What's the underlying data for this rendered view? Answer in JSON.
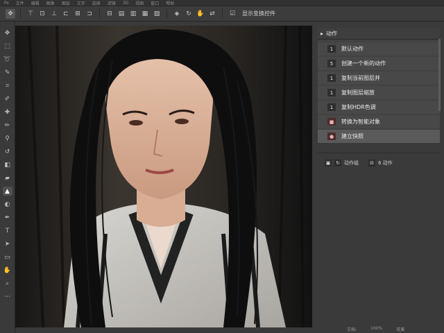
{
  "menubar": {
    "items": [
      "Ps",
      "文件",
      "编辑",
      "图像",
      "图层",
      "文字",
      "选择",
      "滤镜",
      "3D",
      "视图",
      "窗口",
      "帮助"
    ]
  },
  "options": {
    "label": "显示变换控件"
  },
  "panel": {
    "title": "动作",
    "rows": [
      {
        "num": "1",
        "label": "默认动作",
        "active": false,
        "hist": false
      },
      {
        "num": "5",
        "label": "创建一个新的动作",
        "active": false,
        "hist": false
      },
      {
        "num": "1",
        "label": "复制当前图层并",
        "active": false,
        "hist": false
      },
      {
        "num": "1",
        "label": "复制图层缩放",
        "active": false,
        "hist": false
      },
      {
        "num": "1",
        "label": "复制HDR色调",
        "active": false,
        "hist": false
      },
      {
        "num": "■",
        "label": "转换为智能对象",
        "active": false,
        "hist": true
      },
      {
        "num": "●",
        "label": "建立快照",
        "active": true,
        "hist": true
      }
    ],
    "footer": {
      "label1": "动作组",
      "label2": "6 动作"
    }
  },
  "status": [
    "文档:",
    "100%",
    "效果"
  ]
}
